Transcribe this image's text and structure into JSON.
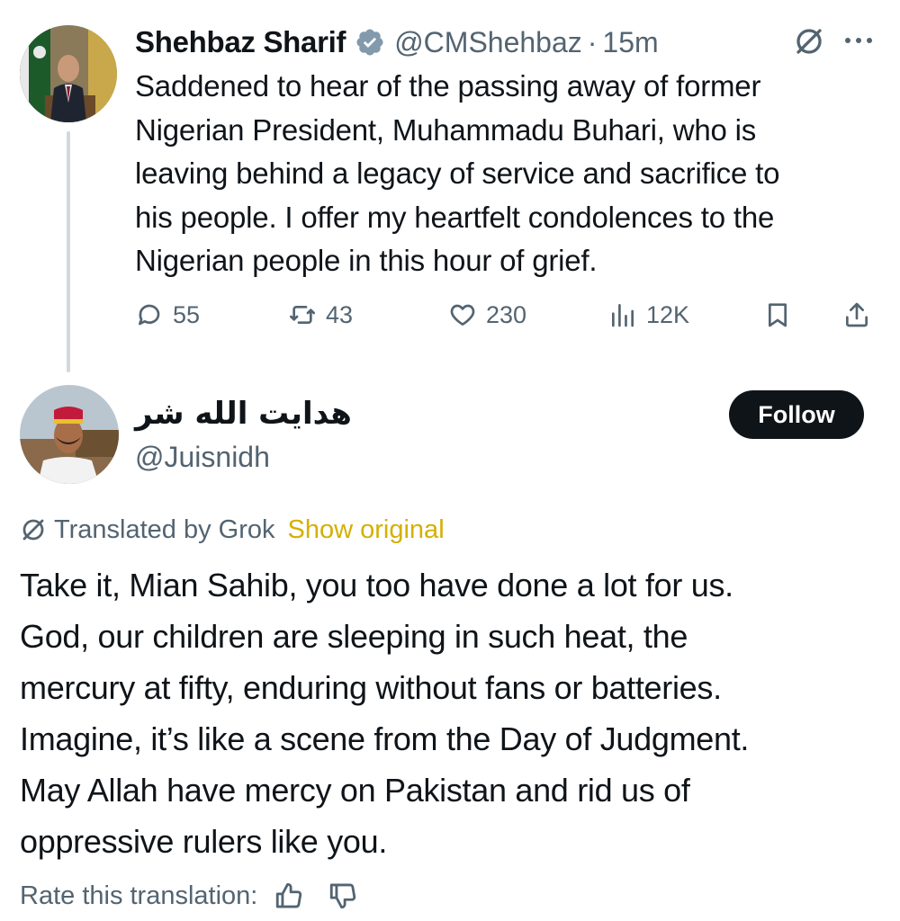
{
  "tweet1": {
    "display_name": "Shehbaz Sharif",
    "handle": "@CMShehbaz",
    "separator": "·",
    "time": "15m",
    "icons": {
      "verified": "verified-badge-icon",
      "grok": "grok-icon",
      "more": "more-icon"
    },
    "body_lines": [
      "Saddened to hear of the passing away of former",
      "Nigerian President, Muhammadu Buhari, who is",
      "leaving behind a legacy of service and sacrifice to",
      "his people. I offer my heartfelt condolences to the",
      "Nigerian people in this hour of grief."
    ],
    "actions": {
      "replies": "55",
      "reposts": "43",
      "likes": "230",
      "views": "12K"
    },
    "colors": {
      "verified": "#829aab"
    }
  },
  "tweet2": {
    "display_name": "هدایت الله شر",
    "handle": "@Juisnidh",
    "follow_label": "Follow",
    "translated_label": "Translated by Grok",
    "show_original_label": "Show original",
    "body_lines": [
      "Take it, Mian Sahib, you too have done a lot for us.",
      "God, our children are sleeping in such heat, the",
      "mercury at fifty, enduring without fans or batteries.",
      "Imagine, it’s like a scene from the Day of Judgment.",
      "May Allah have mercy on Pakistan and rid us of",
      "oppressive rulers like you."
    ],
    "rate_label": "Rate this translation:",
    "colors": {
      "show_original": "#d4b000",
      "follow_bg": "#0f1419"
    }
  }
}
